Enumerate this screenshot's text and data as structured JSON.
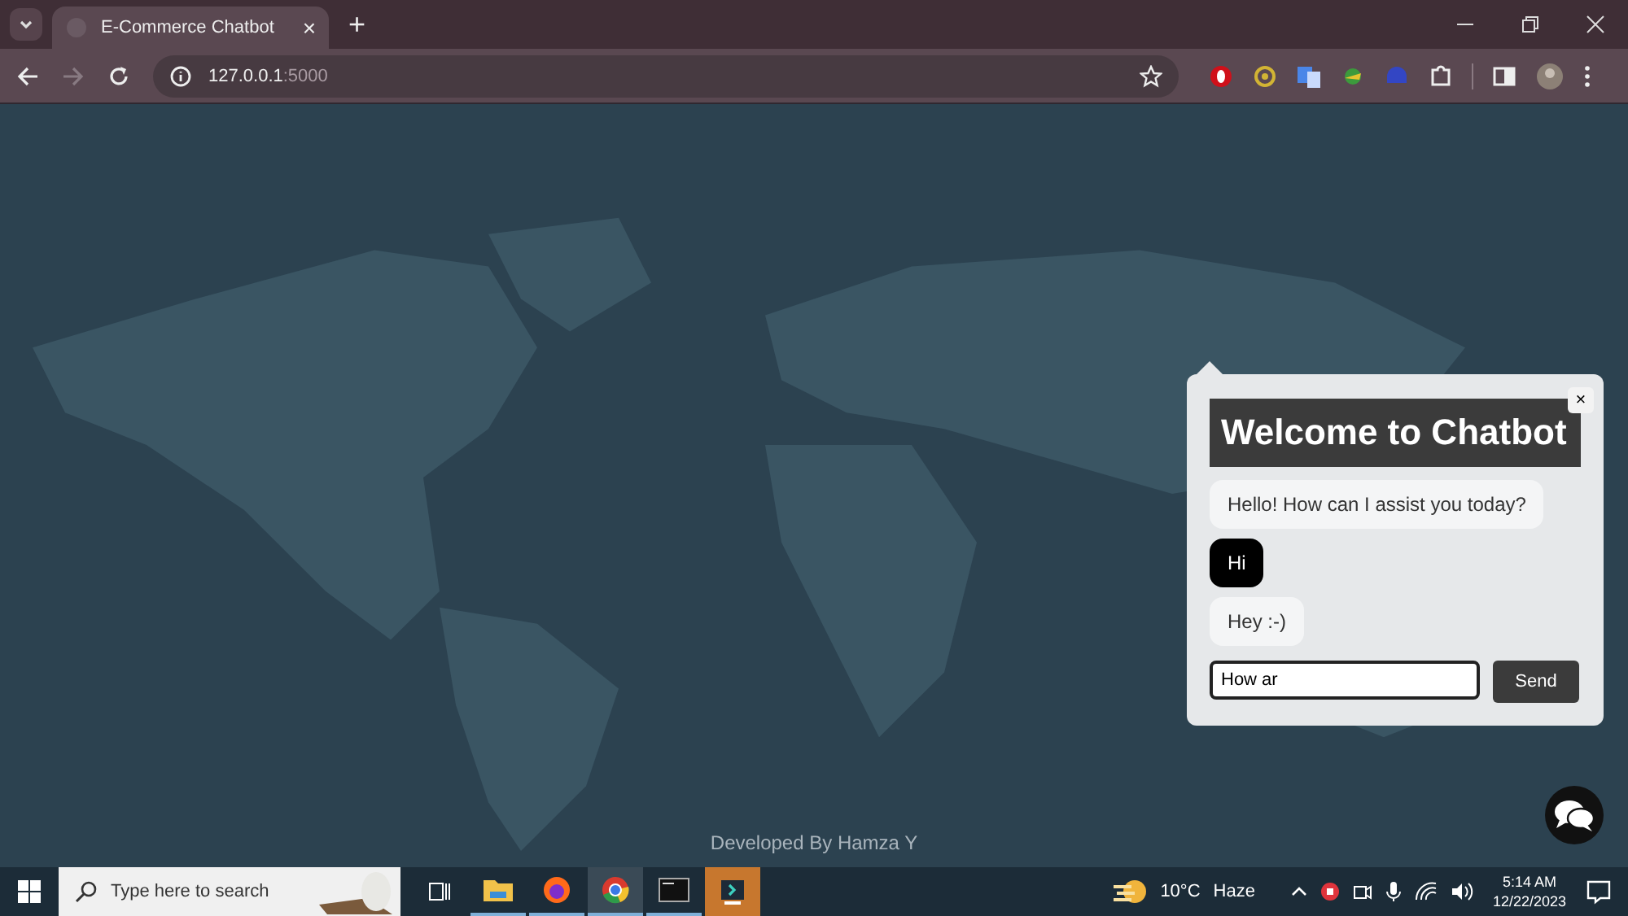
{
  "browser": {
    "tab": {
      "title": "E-Commerce Chatbot",
      "close": "×"
    },
    "new_tab": "+",
    "address": {
      "host": "127.0.0.1",
      "port": ":5000"
    }
  },
  "chatbot": {
    "title": "Welcome to Chatbot",
    "close": "×",
    "messages": [
      {
        "kind": "bot",
        "text": "Hello! How can I assist you today?"
      },
      {
        "kind": "user",
        "text": "Hi"
      },
      {
        "kind": "bot",
        "text": "Hey :-)"
      }
    ],
    "input": {
      "value": "How ar"
    },
    "send": "Send"
  },
  "footer": "Developed By Hamza Y",
  "taskbar": {
    "search": {
      "placeholder": "Type here to search"
    },
    "weather": {
      "temp": "10°C",
      "condition": "Haze"
    },
    "time": "5:14 AM",
    "date": "12/22/2023"
  }
}
